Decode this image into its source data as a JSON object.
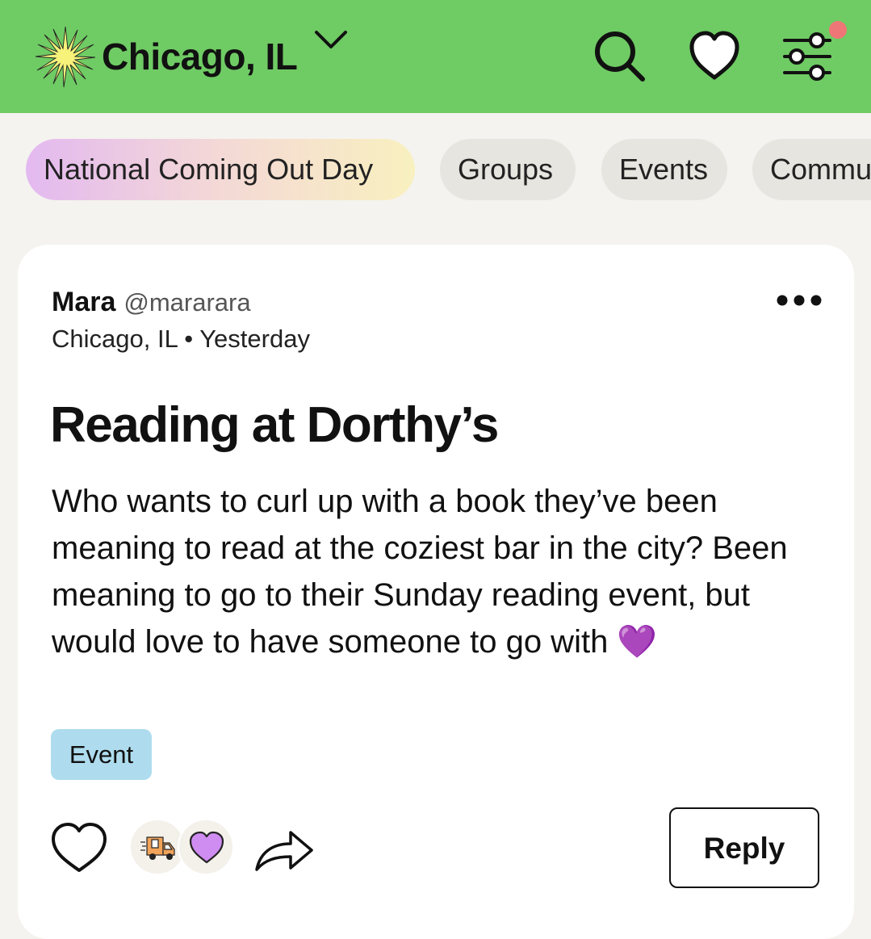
{
  "header": {
    "location": "Chicago, IL",
    "icons": [
      "sun-icon",
      "chevron-down-icon",
      "search-icon",
      "heart-icon",
      "filter-icon"
    ],
    "brand_color": "#6fcb64",
    "notification_dot_color": "#ef7676"
  },
  "chips": [
    {
      "label": "National Coming Out Day"
    },
    {
      "label": "Groups"
    },
    {
      "label": "Events"
    },
    {
      "label": "Community"
    }
  ],
  "post": {
    "author_name": "Mara",
    "author_handle": "@mararara",
    "location": "Chicago, IL",
    "separator": "•",
    "time": "Yesterday",
    "title": "Reading at Dorthy’s",
    "body": "Who wants to curl up with a book they’ve been meaning to read at the coziest bar in the city? Been meaning to go to their Sunday reading event, but would love to have someone to go with 💜",
    "tag": "Event",
    "tag_color": "#aedcee",
    "reactions": [
      "delivery-truck-icon",
      "purple-heart-icon"
    ],
    "reply_label": "Reply"
  }
}
